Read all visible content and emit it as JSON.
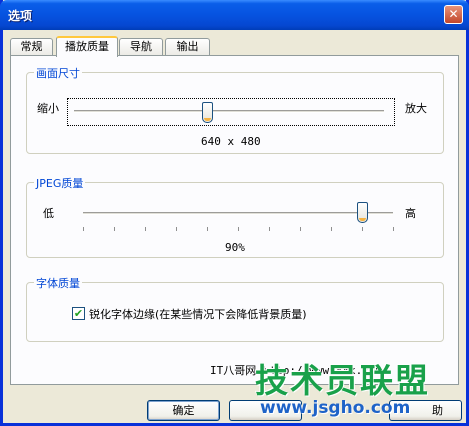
{
  "window": {
    "title": "选项",
    "close_glyph": "✕"
  },
  "tabs": [
    {
      "label": "常规",
      "active": false
    },
    {
      "label": "播放质量",
      "active": true
    },
    {
      "label": "导航",
      "active": false
    },
    {
      "label": "输出",
      "active": false
    }
  ],
  "picture_size": {
    "group_title": "画面尺寸",
    "min_label": "缩小",
    "max_label": "放大",
    "value_text": "640 x 480",
    "slider_fraction": 0.43
  },
  "jpeg_quality": {
    "group_title": "JPEG质量",
    "min_label": "低",
    "max_label": "高",
    "value_text": "90%",
    "slider_value": 90
  },
  "font_quality": {
    "group_title": "字体质量",
    "checkbox_label": "锐化字体边缘(在某些情况下会降低背景质量)",
    "checked": true,
    "check_glyph": "✔"
  },
  "buttons": {
    "ok": "确定",
    "cancel": "",
    "help": "助"
  },
  "watermark": {
    "small_text": "IT八哥网 http://www.xxx.com",
    "logo_text": "技术员联盟",
    "url_text": "www.jsgho.com"
  },
  "colors": {
    "title_bar": "#0653E0",
    "group_title": "#0046D5",
    "panel": "#FCFCFE",
    "dialog": "#ECE9D8",
    "check": "#21A121"
  }
}
